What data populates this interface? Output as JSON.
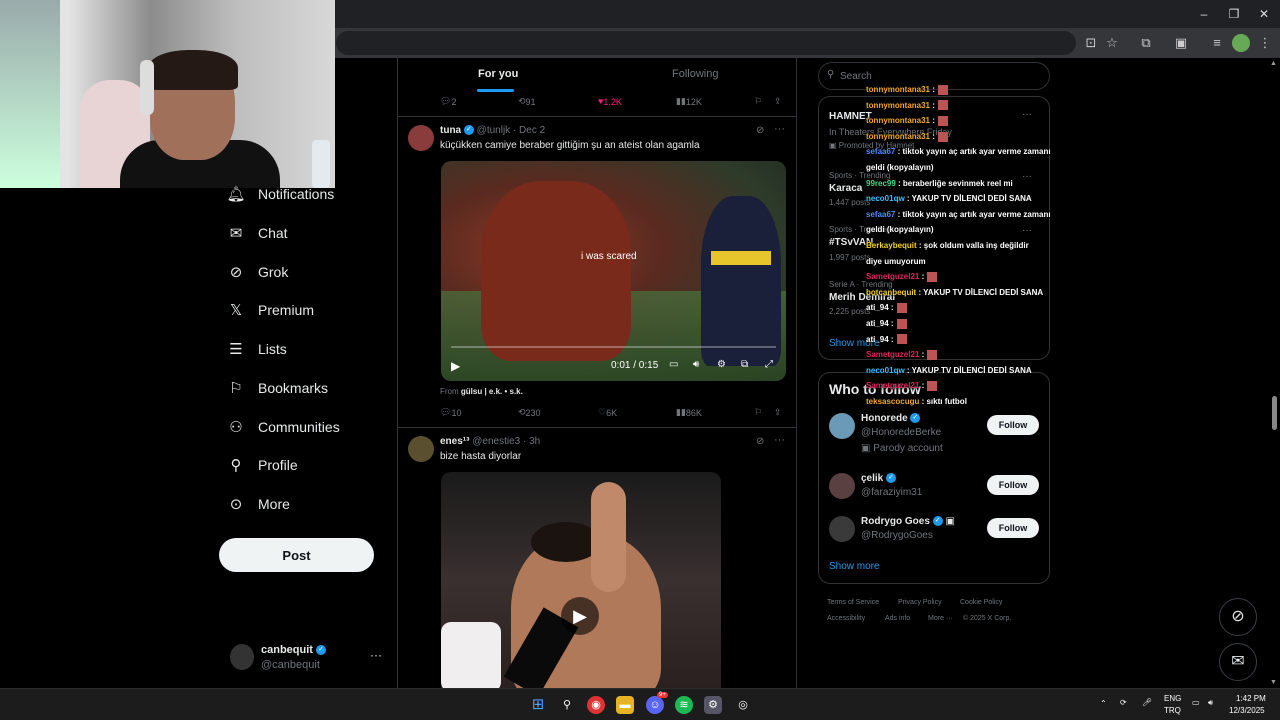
{
  "feed": {
    "tabs": [
      "For you",
      "Following"
    ],
    "prev_actions": {
      "replies": "2",
      "reposts": "91",
      "likes": "1.2K",
      "views": "12K"
    },
    "tweets": [
      {
        "name": "tuna",
        "meta": "@tunljk · Dec 2",
        "text": "küçükken camiye beraber gittiğim şu an ateist olan agamla",
        "video_caption": "i was scared",
        "video_time": "0:01 / 0:15",
        "from_label": "From",
        "from_source": "gülsu | e.k. • s.k.",
        "actions": {
          "replies": "10",
          "reposts": "230",
          "likes": "6K",
          "views": "86K"
        }
      },
      {
        "name": "enes¹³",
        "meta": "@enestie3 · 3h",
        "text": "bize hasta diyorlar"
      }
    ]
  },
  "nav": {
    "items": [
      "Notifications",
      "Chat",
      "Grok",
      "Premium",
      "Lists",
      "Bookmarks",
      "Communities",
      "Profile",
      "More"
    ],
    "post_label": "Post",
    "account": {
      "name": "canbequit",
      "handle": "@canbequit"
    }
  },
  "search": {
    "placeholder": "Search"
  },
  "trends": [
    {
      "context": "",
      "title": "HAMNET",
      "sub": "In Theaters Everywhere Friday",
      "promo": "Promoted by Hamnet"
    },
    {
      "context": "Sports · Trending",
      "title": "Karaca",
      "sub": "1,447 posts"
    },
    {
      "context": "Sports · Trending",
      "title": "#TSvVAN",
      "sub": "1,997 posts"
    },
    {
      "context": "Serie A · Trending",
      "title": "Merih Demiral",
      "sub": "2,225 posts"
    }
  ],
  "trends_show_more": "Show more",
  "who_to_follow": {
    "title": "Who to follow",
    "people": [
      {
        "name": "Honorede",
        "handle": "@HonoredeBerke",
        "extra": "Parody account",
        "button": "Follow"
      },
      {
        "name": "çelik",
        "handle": "@faraziyim31",
        "extra": "",
        "button": "Follow"
      },
      {
        "name": "Rodrygo Goes",
        "handle": "@RodrygoGoes",
        "extra": "",
        "button": "Follow"
      }
    ],
    "show_more": "Show more"
  },
  "footer": {
    "links": [
      "Terms of Service",
      "Privacy Policy",
      "Cookie Policy",
      "Accessibility",
      "Ads info",
      "More ···",
      "© 2025 X Corp."
    ]
  },
  "chat": [
    {
      "user": "tonnymontana31",
      "msg": " :",
      "color": "#f5a623"
    },
    {
      "user": "tonnymontana31",
      "msg": " :",
      "color": "#f5a623"
    },
    {
      "user": "tonnymontana31",
      "msg": " :",
      "color": "#f5a623"
    },
    {
      "user": "tonnymontana31",
      "msg": " :",
      "color": "#f5a623"
    },
    {
      "user": "sefaa67",
      "msg": " : tiktok yayın aç artık ayar verme zamanı",
      "color": "#4f8bff"
    },
    {
      "user": "",
      "msg": "geldi (kopyalayın)",
      "color": "#fff"
    },
    {
      "user": "99rec99",
      "msg": " : beraberliğe sevinmek reel mi",
      "color": "#3ddc84"
    },
    {
      "user": "neco01qw",
      "msg": " : YAKUP TV DİLENCİ DEDİ SANA",
      "color": "#33c3ff"
    },
    {
      "user": "sefaa67",
      "msg": " : tiktok yayın aç artık ayar verme zamanı",
      "color": "#4f8bff"
    },
    {
      "user": "",
      "msg": "geldi (kopyalayın)",
      "color": "#fff"
    },
    {
      "user": "Berkaybequit",
      "msg": " : şok oldum valla inş değildir",
      "color": "#f5d020"
    },
    {
      "user": "",
      "msg": "diye umuyorum",
      "color": "#fff"
    },
    {
      "user": "Sametguzel21",
      "msg": " :",
      "color": "#e0245e"
    },
    {
      "user": "botcanbequit",
      "msg": " : YAKUP TV DİLENCİ DEDİ SANA",
      "color": "#f5d020"
    },
    {
      "user": "ati_94",
      "msg": " :",
      "color": "#fff"
    },
    {
      "user": "ati_94",
      "msg": " :",
      "color": "#fff"
    },
    {
      "user": "ati_94",
      "msg": " :",
      "color": "#fff"
    },
    {
      "user": "Sametguzel21",
      "msg": " :",
      "color": "#e0245e"
    },
    {
      "user": "neco01qw",
      "msg": " : YAKUP TV DİLENCİ DEDİ SANA",
      "color": "#33c3ff"
    },
    {
      "user": "Sametguzel21",
      "msg": " :",
      "color": "#e0245e"
    },
    {
      "user": "teksascocugu",
      "msg": " : sıktı futbol",
      "color": "#f5a623"
    }
  ],
  "taskbar": {
    "lang_top": "ENG",
    "lang_bottom": "TRQ",
    "time": "1:42 PM",
    "date": "12/3/2025",
    "discord_badge": "9+"
  },
  "colors": {
    "accent": "#1d9bf0",
    "like": "#f91880"
  }
}
